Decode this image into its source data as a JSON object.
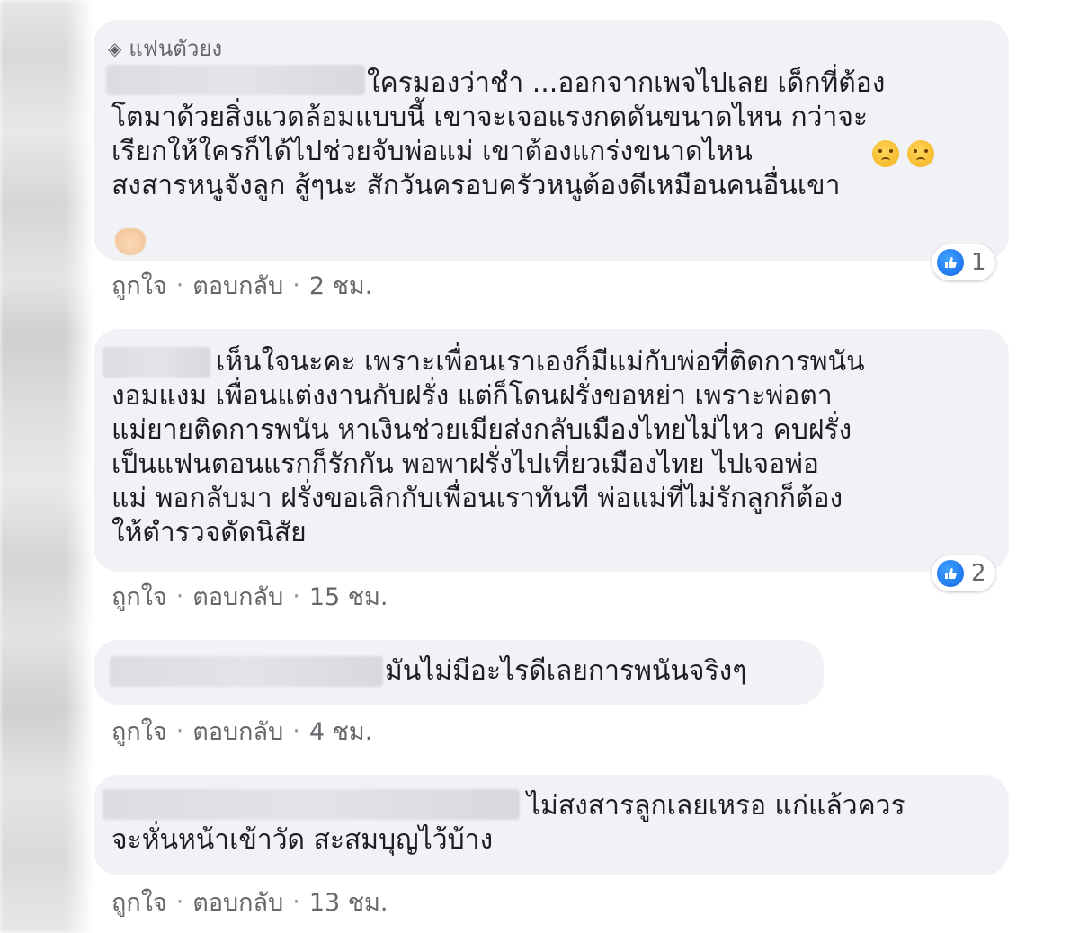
{
  "comments": [
    {
      "badge": "แฟนตัวยง",
      "text": "ใครมองว่าชำ ...ออกจากเพจไปเลย เด็กที่ต้อง\nโตมาด้วยสิ่งแวดล้อมแบบนี้ เขาจะเจอแรงกดดันขนาดไหน กว่าจะ\nเรียกให้ใครก็ได้ไปช่วยจับพ่อแม่ เขาต้องแกร่งขนาดไหน\nสงสารหนูจังลูก สู้ๆนะ สักวันครอบครัวหนูต้องดีเหมือนคนอื่นเขา",
      "like_label": "ถูกใจ",
      "reply_label": "ตอบกลับ",
      "time": "2 ชม.",
      "reaction_count": "1"
    },
    {
      "text": "เห็นใจนะคะ เพราะเพื่อนเราเองก็มีแม่กับพ่อที่ติดการพนัน\nงอมแงม เพื่อนแต่งงานกับฝรั่ง แต่ก็โดนฝรั่งขอหย่า เพราะพ่อตา\nแม่ยายติดการพนัน หาเงินช่วยเมียส่งกลับเมืองไทยไม่ไหว คบฝรั่ง\nเป็นแฟนตอนแรกก็รักกัน พอพาฝรั่งไปเที่ยวเมืองไทย ไปเจอพ่อ\nแม่ พอกลับมา ฝรั่งขอเลิกกับเพื่อนเราทันที พ่อแม่ที่ไม่รักลูกก็ต้อง\nให้ตำรวจดัดนิสัย",
      "like_label": "ถูกใจ",
      "reply_label": "ตอบกลับ",
      "time": "15 ชม.",
      "reaction_count": "2"
    },
    {
      "text": "มันไม่มีอะไรดีเลยการพนันจริงๆ",
      "like_label": "ถูกใจ",
      "reply_label": "ตอบกลับ",
      "time": "4 ชม."
    },
    {
      "text": "ไม่สงสารลูกเลยเหรอ แก่แล้วควร\nจะหั่นหน้าเข้าวัด สะสมบุญไว้บ้าง",
      "like_label": "ถูกใจ",
      "reply_label": "ตอบกลับ",
      "time": "13 ชม."
    }
  ],
  "icons": {
    "badge": "diamond-icon",
    "reaction": "like-thumb-icon",
    "emoji": "crying-face-icon"
  },
  "colors": {
    "bubble": "#f0f2f5",
    "meta_text": "#65676b",
    "like_blue": "#1877f2"
  }
}
